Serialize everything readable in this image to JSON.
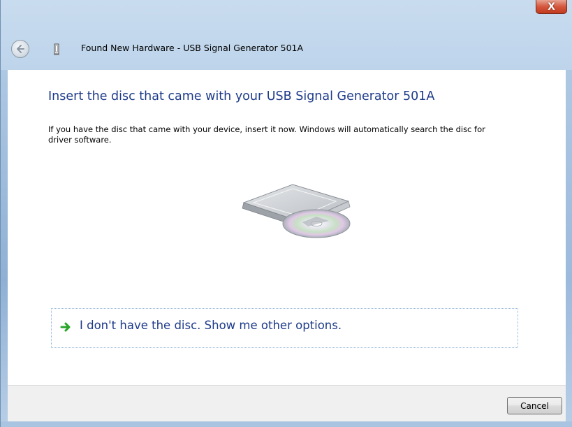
{
  "window": {
    "title": "Found New Hardware - USB Signal Generator 501A",
    "close_glyph": "X"
  },
  "page": {
    "heading": "Insert the disc that came with your USB Signal Generator 501A",
    "description": "If you have the disc that came with your device, insert it now.  Windows will automatically search the disc for driver software."
  },
  "option": {
    "label": "I don't have the disc.  Show me other options."
  },
  "footer": {
    "cancel_label": "Cancel"
  },
  "icons": {
    "back": "back-arrow-icon",
    "device": "usb-device-icon",
    "disc": "disc-drive-icon",
    "option_arrow": "green-arrow-icon"
  },
  "colors": {
    "heading": "#1e3b8a",
    "close": "#c23b1e",
    "arrow": "#2aa52a"
  }
}
